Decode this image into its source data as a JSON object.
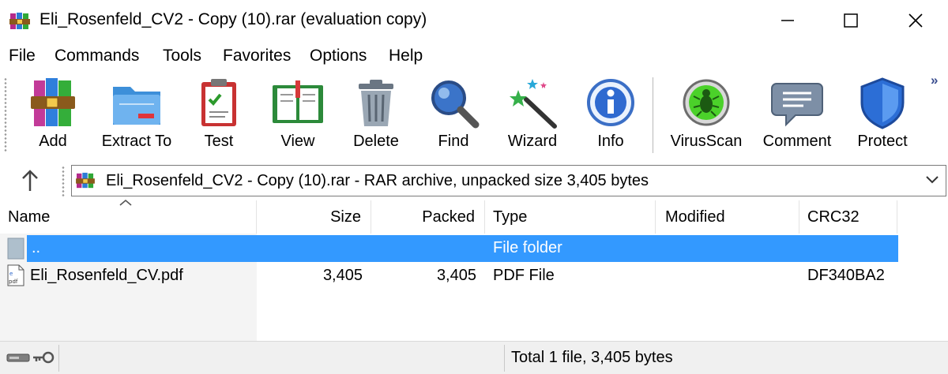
{
  "window": {
    "title": "Eli_Rosenfeld_CV2 - Copy (10).rar (evaluation copy)",
    "icon": "winrar-books-icon"
  },
  "menu": [
    "File",
    "Commands",
    "Tools",
    "Favorites",
    "Options",
    "Help"
  ],
  "toolbar": {
    "buttons": [
      {
        "label": "Add",
        "icon": "books-add-icon"
      },
      {
        "label": "Extract To",
        "icon": "folder-extract-icon"
      },
      {
        "label": "Test",
        "icon": "clipboard-check-icon"
      },
      {
        "label": "View",
        "icon": "open-book-icon"
      },
      {
        "label": "Delete",
        "icon": "trash-can-icon"
      },
      {
        "label": "Find",
        "icon": "magnifier-icon"
      },
      {
        "label": "Wizard",
        "icon": "magic-wand-icon"
      },
      {
        "label": "Info",
        "icon": "info-icon"
      },
      {
        "label": "VirusScan",
        "icon": "bug-scan-icon"
      },
      {
        "label": "Comment",
        "icon": "comment-icon"
      },
      {
        "label": "Protect",
        "icon": "shield-icon"
      }
    ],
    "overflow_glyph": "»"
  },
  "address": {
    "text": "Eli_Rosenfeld_CV2 - Copy (10).rar - RAR archive, unpacked size 3,405 bytes"
  },
  "columns": [
    "Name",
    "Size",
    "Packed",
    "Type",
    "Modified",
    "CRC32"
  ],
  "rows": [
    {
      "name": "..",
      "size": "",
      "packed": "",
      "type": "File folder",
      "modified": "",
      "crc": "",
      "selected": true
    },
    {
      "name": "Eli_Rosenfeld_CV.pdf",
      "size": "3,405",
      "packed": "3,405",
      "type": "PDF File",
      "modified": "",
      "crc": "DF340BA2",
      "selected": false
    }
  ],
  "status": {
    "text": "Total 1 file, 3,405 bytes"
  },
  "colors": {
    "selection": "#3399ff",
    "window_bg": "#ffffff",
    "status_bg": "#f0f0f0"
  }
}
